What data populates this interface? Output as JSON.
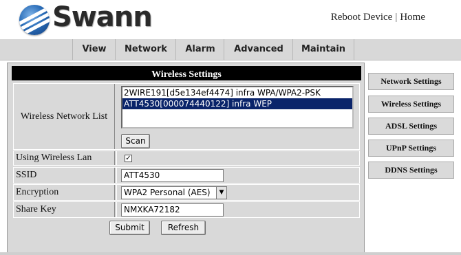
{
  "header": {
    "brand": "Swann",
    "links": [
      "Reboot Device",
      "Home"
    ],
    "separator": "|"
  },
  "nav": {
    "items": [
      "View",
      "Network",
      "Alarm",
      "Advanced",
      "Maintain"
    ]
  },
  "wireless": {
    "title": "Wireless Settings",
    "network_list_label": "Wireless Network List",
    "networks": [
      "2WIRE191[d5e134ef4474] infra WPA/WPA2-PSK",
      "ATT4530[000074440122] infra WEP"
    ],
    "selected_index": 1,
    "scan_label": "Scan",
    "using_wlan_label": "Using Wireless Lan",
    "using_wlan_checked": true,
    "check_glyph": "✓",
    "ssid_label": "SSID",
    "ssid_value": "ATT4530",
    "encryption_label": "Encryption",
    "encryption_value": "WPA2 Personal (AES)",
    "dropdown_glyph": "▼",
    "share_key_label": "Share Key",
    "share_key_value": "NMXKA72182",
    "submit_label": "Submit",
    "refresh_label": "Refresh"
  },
  "sidebar": {
    "items": [
      "Network Settings",
      "Wireless Settings",
      "ADSL Settings",
      "UPnP Settings",
      "DDNS Settings"
    ]
  }
}
